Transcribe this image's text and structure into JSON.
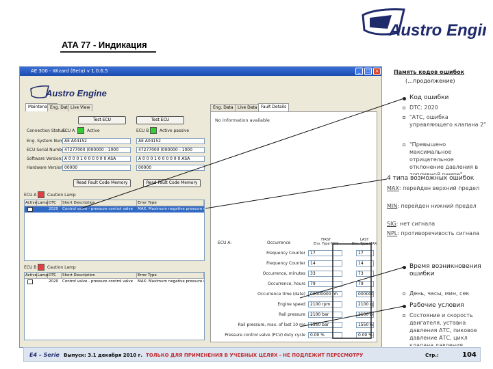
{
  "brand": {
    "logo_text": "Austro Engine"
  },
  "slide": {
    "title": "ATA 77 - Индикация"
  },
  "window": {
    "title": "AE 300 - Wizard (Beta) v 1.0.6.5",
    "min": "_",
    "max": "□",
    "close": "×",
    "app_logo": "Austro Engine",
    "tabs_left": [
      "Maintenance",
      "Eng. Data",
      "Live View"
    ],
    "tabs_right": [
      "Eng. Data",
      "Live Data",
      "Fault Details"
    ],
    "button_ecu_a_test": "Test ECU",
    "button_ecu_b_test": "Test ECU",
    "labels": {
      "connection_status": "Connection Status:",
      "eng_system_number": "Eng. System Number:",
      "ecu_serial_number": "ECU Serial Number:",
      "software_version": "Software Version:",
      "hardware_version": "Hardware Version:",
      "ecu_a": "ECU A",
      "ecu_b": "ECU B",
      "active": "Active",
      "active_passive": "Active passive",
      "caution_lamp": "Caution Lamp",
      "no_info": "No Information available"
    },
    "values_a": {
      "eng": "AE A04152",
      "serial": "47277000 (000000 - 1000",
      "software": "A 0 0 0 1 0 0 0 0 0 0 ASA",
      "hardware": "00000"
    },
    "values_b": {
      "eng": "AE A04152",
      "serial": "47277000 (000000 - 1000",
      "software": "A 0 0 0 1 0 0 0 0 0 0 ASA",
      "hardware": "00000"
    },
    "read_fault_a": "Read Fault Code Memory",
    "read_fault_b": "Read Fault Code Memory",
    "grid_headers": [
      "Active",
      "Lamp",
      "DTC",
      "Short Description",
      "Error Type"
    ],
    "grid_a_rows": [
      {
        "dtc": "2020",
        "desc": "Control valve - pressure control valve",
        "err": "MAX: Maximum negative pressure dev"
      }
    ],
    "grid_b_rows": [
      {
        "dtc": "2020",
        "desc": "Control valve - pressure control valve",
        "err": "MAX: Maximum negative pressure dev"
      }
    ],
    "detail": {
      "ecu_label": "ECU A:",
      "col_freq": "Occurrence",
      "col_first": "FIRST\nEnv. Type MAX",
      "col_last": "LAST\nEnv. Type MAX",
      "rows": [
        {
          "label": "Frequency Counter",
          "first": "17",
          "last": "17"
        },
        {
          "label": "Frequency Counter",
          "first": "14",
          "last": "14"
        },
        {
          "label": "Occurrence, minutes",
          "first": "33",
          "last": "73"
        },
        {
          "label": "Occurrence, hours",
          "first": "79",
          "last": "79"
        },
        {
          "label": "Occurrence time (date)",
          "first": "00000000 hh",
          "last": "00000000 hh"
        },
        {
          "label": "Engine speed",
          "first": "2100 rpm",
          "last": "2100 rpm"
        },
        {
          "label": "Rail pressure",
          "first": "2100 bar",
          "last": "2100 bar"
        },
        {
          "label": "Rail pressure, max. of last 10 ms",
          "first": "1550 bar",
          "last": "1550 bar"
        },
        {
          "label": "Pressure control valve (PCV) duty cycle",
          "first": "0.00 %",
          "last": "0.00 %"
        }
      ]
    }
  },
  "notes": {
    "memory_title": "Память кодов ошибок",
    "memory_subtitle": "(…продолжение)",
    "code_title": "Код ошибки",
    "code_items": [
      "DTC: 2020",
      "\"АТС, ошибка управляющего клапана 2\"",
      "\"Превышено максимальное отрицательное отклонение давления в топливной рампе\""
    ],
    "types_title": "4 типа возможных ошибок",
    "types": [
      {
        "abbr": "MAX",
        "text": ": перейден верхний предел"
      },
      {
        "abbr": "MIN",
        "text": ": перейден нижний предел"
      },
      {
        "abbr": "SIG",
        "text": ": нет сигнала"
      },
      {
        "abbr": "NPL",
        "text": ": противоречивость сигнала"
      }
    ],
    "time_title": "Время возникновения ошибки",
    "time_item": "День, часы, мин, сек",
    "cond_title": "Рабочие условия",
    "cond_item": "Состояние и скорость двигателя, уставка давления АТС, пиковое давление АТС, цикл клапана давления"
  },
  "footer": {
    "series": "E4 – Serie",
    "issue": "Выпуск: 3.1 декабря 2010 г.",
    "warning": "ТОЛЬКО ДЛЯ ПРИМЕНЕНИЯ В УЧЕБНЫХ ЦЕЛЯХ - НЕ ПОДЛЕЖИТ ПЕРЕСМОТРУ",
    "page_label": "Стр.:",
    "page_number": "104"
  },
  "colors": {
    "accent_red": "#c0282d",
    "brand_navy": "#1f2a6b",
    "led_green": "#33cc33",
    "led_red": "#e04040"
  }
}
